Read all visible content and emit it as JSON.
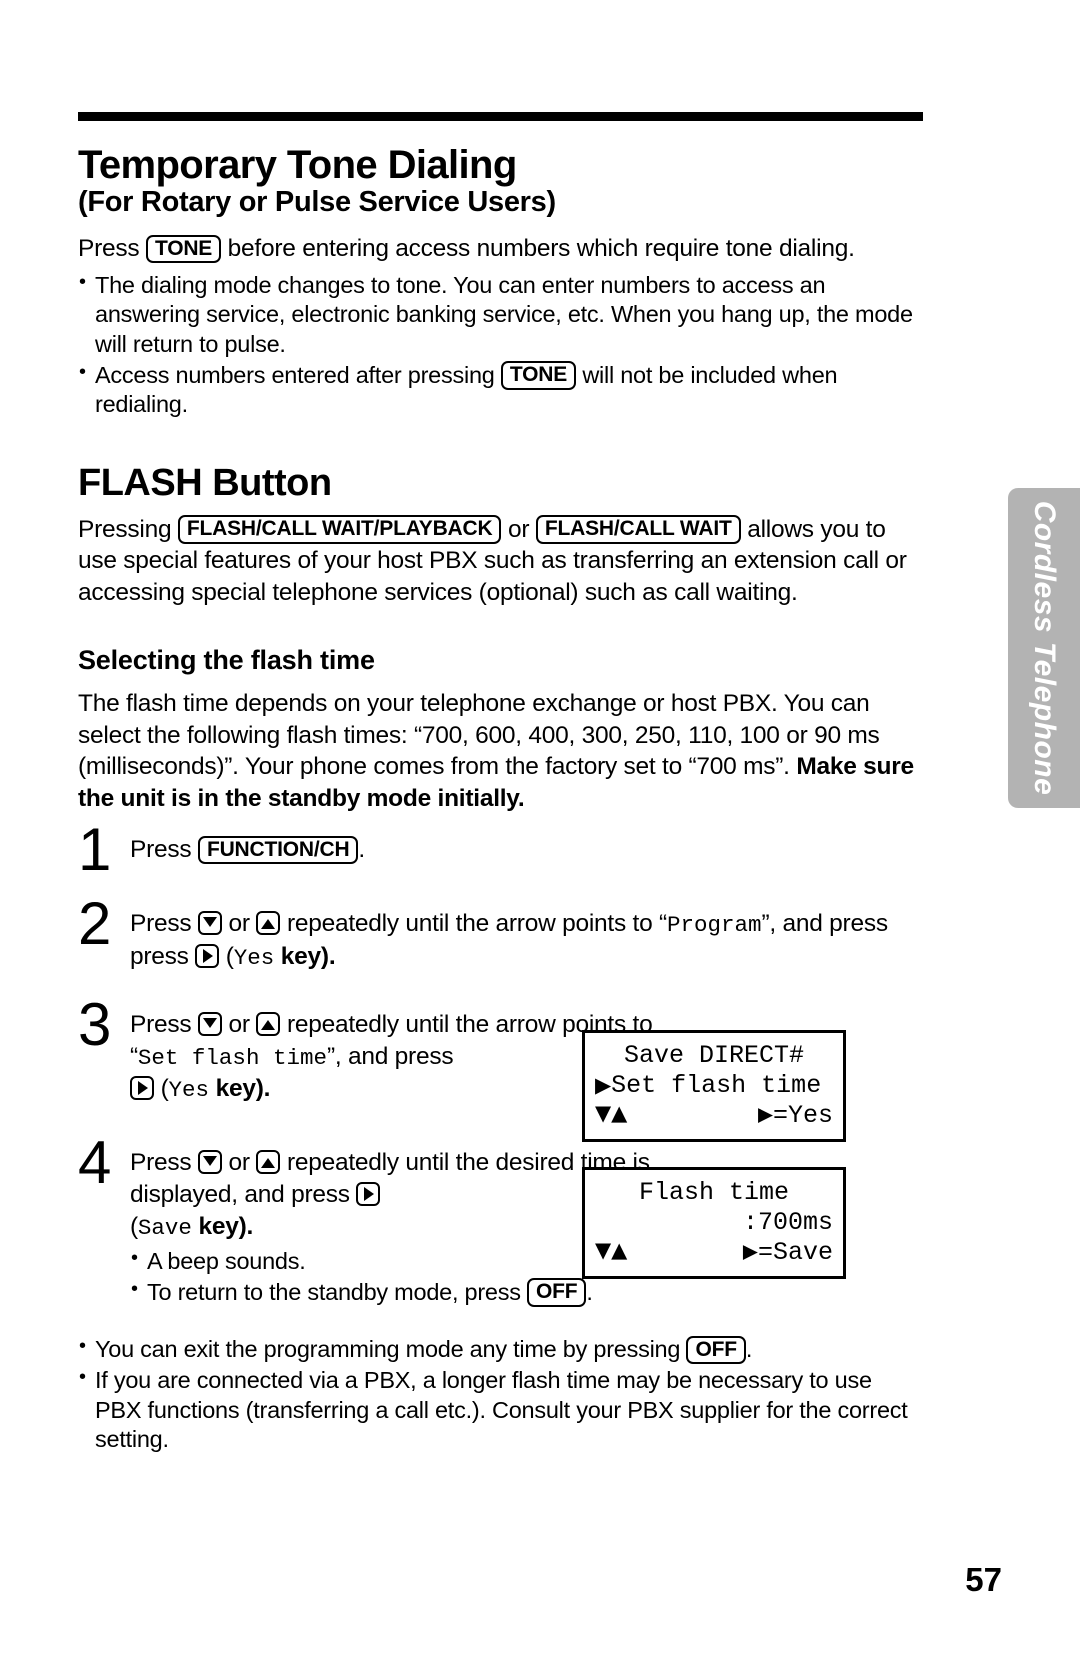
{
  "document": {
    "page_number": "57",
    "side_tab_label": "Cordless Telephone"
  },
  "section_tone": {
    "title": "Temporary Tone Dialing",
    "subtitle": "(For Rotary or Pulse Service Users)",
    "intro_before": "Press",
    "intro_key": "TONE",
    "intro_after": "before entering access numbers which require tone dialing.",
    "bullets": [
      {
        "text": "The dialing mode changes to tone. You can enter numbers to access an answering service, electronic banking service, etc. When you hang up, the mode will return to pulse."
      },
      {
        "before": "Access numbers entered after pressing",
        "key": "TONE",
        "after": "will not be included when redialing."
      }
    ]
  },
  "section_flash": {
    "title": "FLASH Button",
    "intro_before": "Pressing",
    "key_1": "FLASH/CALL WAIT/PLAYBACK",
    "intro_middle": "or",
    "key_2": "FLASH/CALL WAIT",
    "intro_after": "allows you to use special features of your host PBX such as transferring an extension call or accessing special telephone services (optional) such as call waiting."
  },
  "section_select": {
    "heading": "Selecting the flash time",
    "paragraph_part1": "The flash time depends on your telephone exchange or host PBX. You can select the following flash times: “700, 600, 400, 300, 250, 110, 100 or 90 ms (milliseconds)”. Your phone comes from the factory set to “700 ms”. ",
    "paragraph_bold": "Make sure the unit is in the standby mode initially.",
    "flash_times": [
      "700",
      "600",
      "400",
      "300",
      "250",
      "110",
      "100",
      "90"
    ],
    "factory_default": "700 ms"
  },
  "steps": [
    {
      "number": "1",
      "press_label": "Press",
      "key": "FUNCTION/CH",
      "period": "."
    },
    {
      "number": "2",
      "press_label": "Press",
      "key_down": "down-arrow-key",
      "or_label": "or",
      "key_up": "up-arrow-key",
      "text_mid": "repeatedly until the arrow points to",
      "quoted_target": "Program",
      "text_after": ", and press",
      "key_right": "right-arrow-key",
      "paren_open": "(",
      "key_name": "Yes",
      "key_word": "key).",
      "press_label_2": "press"
    },
    {
      "number": "3",
      "press_label": "Press",
      "or_label": "or",
      "text_mid": "repeatedly until the arrow points to",
      "quoted_target": "Set flash time",
      "text_after": ", and press",
      "paren_open": "(",
      "key_name": "Yes",
      "key_word": "key)."
    },
    {
      "number": "4",
      "press_label": "Press",
      "or_label": "or",
      "text_mid": "repeatedly until the desired time is displayed, and press",
      "paren_open": "(",
      "key_name": "Save",
      "key_word": "key).",
      "sub_bullets": [
        {
          "text": "A beep sounds."
        },
        {
          "before": "To return to the standby mode, press",
          "key": "OFF",
          "after": "."
        }
      ]
    }
  ],
  "lcd_displays": [
    {
      "name": "set-flash-time-display",
      "line1": "Save DIRECT#",
      "line2_marker": "▶",
      "line2": "Set flash time",
      "line3_left": "▼▲",
      "line3_right": "▶=Yes"
    },
    {
      "name": "flash-time-display",
      "line1": "Flash time",
      "line2": ":700ms",
      "line3_left": "▼▲",
      "line3_right": "▶=Save"
    }
  ],
  "bottom_notes": [
    {
      "before": "You can exit the programming mode any time by pressing",
      "key": "OFF",
      "after": "."
    },
    {
      "text": "If you are connected via a PBX, a longer flash time may be necessary to use PBX functions (transferring a call etc.). Consult your PBX supplier for the correct setting."
    }
  ]
}
